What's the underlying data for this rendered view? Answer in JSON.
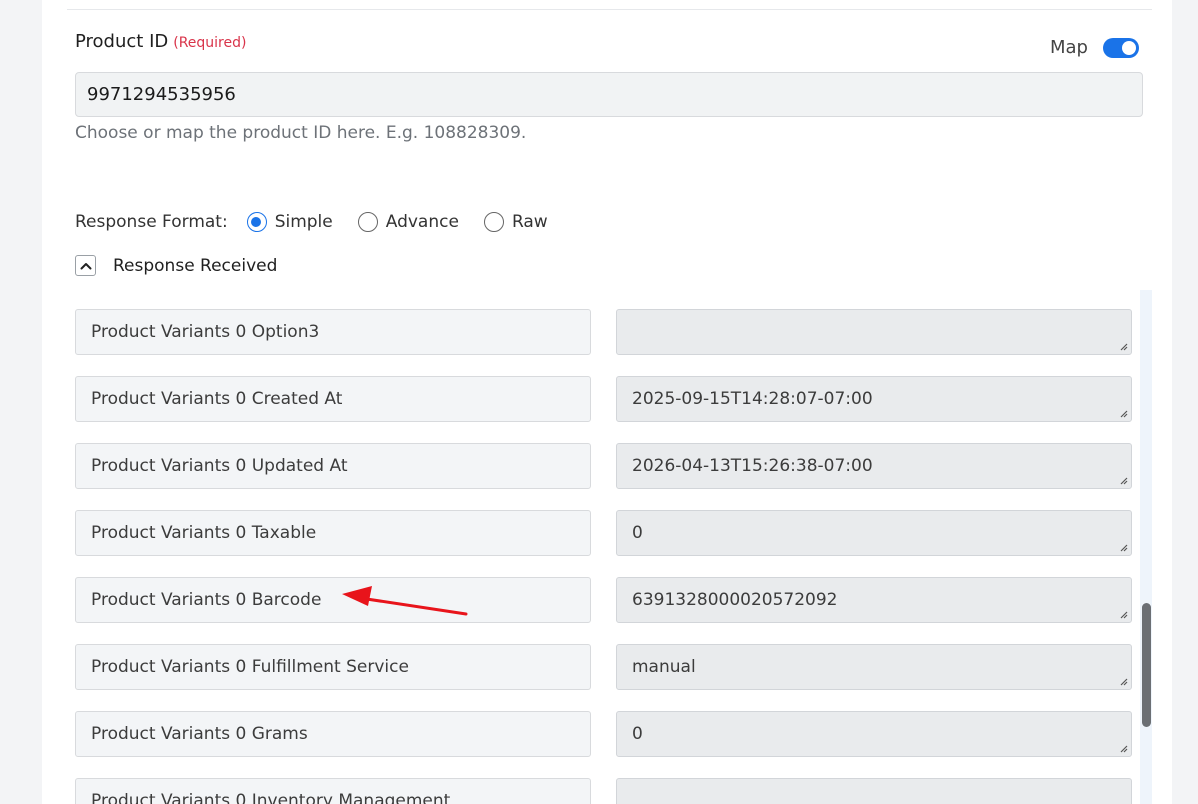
{
  "product_id": {
    "label": "Product ID",
    "required": "(Required)",
    "value": "9971294535956",
    "hint": "Choose or map the product ID here.  E.g. 108828309."
  },
  "map": {
    "label": "Map",
    "enabled": true
  },
  "response_format": {
    "label": "Response Format:",
    "options": [
      "Simple",
      "Advance",
      "Raw"
    ],
    "selected": "Simple"
  },
  "response_received": {
    "label": "Response Received"
  },
  "rows": [
    {
      "key": "Product Variants 0 Option3",
      "value": ""
    },
    {
      "key": "Product Variants 0 Created At",
      "value": "2025-09-15T14:28:07-07:00"
    },
    {
      "key": "Product Variants 0 Updated At",
      "value": "2026-04-13T15:26:38-07:00"
    },
    {
      "key": "Product Variants 0 Taxable",
      "value": "0"
    },
    {
      "key": "Product Variants 0 Barcode",
      "value": "6391328000020572092"
    },
    {
      "key": "Product Variants 0 Fulfillment Service",
      "value": "manual"
    },
    {
      "key": "Product Variants 0 Grams",
      "value": "0"
    },
    {
      "key": "Product Variants 0 Inventory Management",
      "value": ""
    }
  ],
  "colors": {
    "accent": "#1a73e8",
    "required": "#d9344a",
    "annotation_arrow": "#e8141b"
  },
  "icons": {
    "collapse": "chevron-up-icon",
    "resize": "resize-grip-icon",
    "annotation": "red-arrow-icon"
  }
}
